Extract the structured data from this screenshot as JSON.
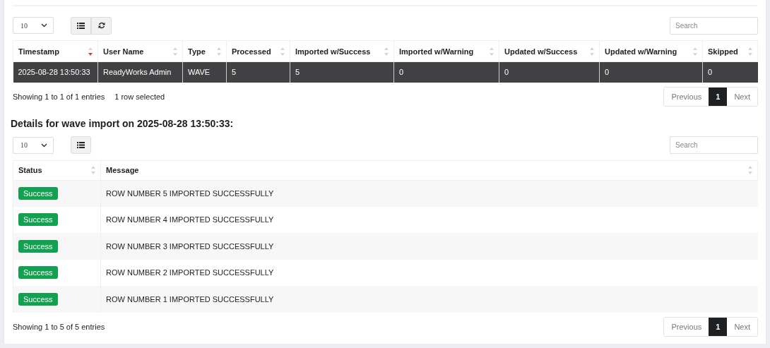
{
  "summary": {
    "page_length": "10",
    "tools": [
      {
        "kind": "list"
      },
      {
        "kind": "refresh"
      }
    ],
    "search": {
      "placeholder": "Search"
    },
    "columns": [
      {
        "label": "Timestamp",
        "sorted": true
      },
      {
        "label": "User Name",
        "sorted": false
      },
      {
        "label": "Type",
        "sorted": false
      },
      {
        "label": "Processed",
        "sorted": false
      },
      {
        "label": "Imported w/Success",
        "sorted": false
      },
      {
        "label": "Imported w/Warning",
        "sorted": false
      },
      {
        "label": "Updated w/Success",
        "sorted": false
      },
      {
        "label": "Updated w/Warning",
        "sorted": false
      },
      {
        "label": "Skipped",
        "sorted": false
      }
    ],
    "rows": [
      {
        "selected": true,
        "cells": [
          "2025-08-28 13:50:33",
          "ReadyWorks Admin",
          "WAVE",
          "5",
          "5",
          "0",
          "0",
          "0",
          "0"
        ]
      }
    ],
    "info": "Showing 1 to 1 of 1 entries",
    "selection_info": "1 row selected",
    "pagination": {
      "previous": "Previous",
      "pages": [
        {
          "label": "1",
          "selected": true
        }
      ],
      "next": "Next"
    }
  },
  "details_title": "Details for wave import on 2025-08-28 13:50:33:",
  "details": {
    "page_length": "10",
    "tools": [
      {
        "kind": "list"
      }
    ],
    "search": {
      "placeholder": "Search"
    },
    "columns": [
      {
        "label": "Status",
        "sorted": false
      },
      {
        "label": "Message",
        "sorted": false
      }
    ],
    "rows": [
      {
        "selected": false,
        "cells": [
          {
            "kind": "success",
            "label": "Success"
          },
          "ROW NUMBER 5 IMPORTED SUCCESSFULLY"
        ]
      },
      {
        "selected": false,
        "cells": [
          {
            "kind": "success",
            "label": "Success"
          },
          "ROW NUMBER 4 IMPORTED SUCCESSFULLY"
        ]
      },
      {
        "selected": false,
        "cells": [
          {
            "kind": "success",
            "label": "Success"
          },
          "ROW NUMBER 3 IMPORTED SUCCESSFULLY"
        ]
      },
      {
        "selected": false,
        "cells": [
          {
            "kind": "success",
            "label": "Success"
          },
          "ROW NUMBER 2 IMPORTED SUCCESSFULLY"
        ]
      },
      {
        "selected": false,
        "cells": [
          {
            "kind": "success",
            "label": "Success"
          },
          "ROW NUMBER 1 IMPORTED SUCCESSFULLY"
        ]
      }
    ],
    "info": "Showing 1 to 5 of 5 entries",
    "pagination": {
      "previous": "Previous",
      "pages": [
        {
          "label": "1",
          "selected": true
        }
      ],
      "next": "Next"
    }
  }
}
